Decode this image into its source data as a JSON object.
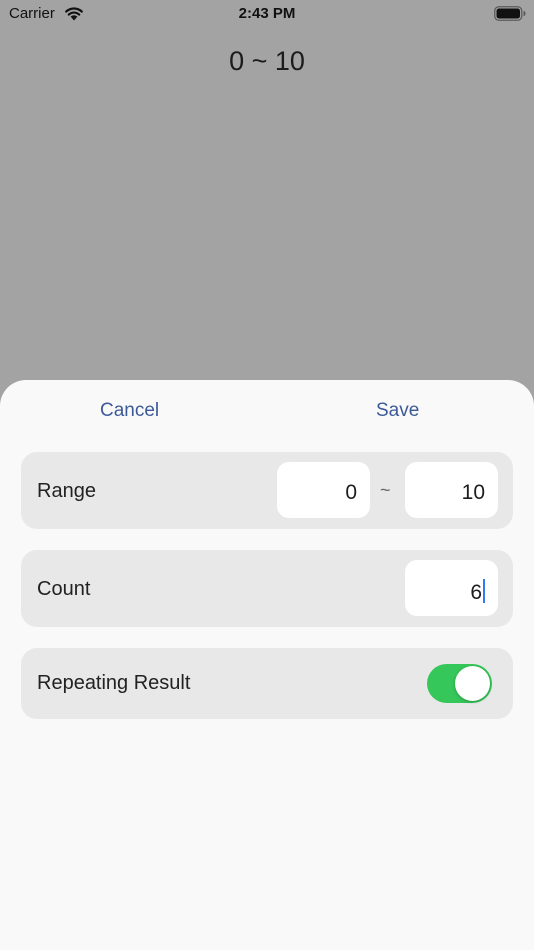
{
  "status_bar": {
    "carrier": "Carrier",
    "time": "2:43 PM",
    "icons": [
      "wifi-icon",
      "battery-icon"
    ]
  },
  "header": {
    "range_text": "0 ~ 10"
  },
  "sheet": {
    "cancel_label": "Cancel",
    "save_label": "Save",
    "range": {
      "label": "Range",
      "min_value": "0",
      "separator": "~",
      "max_value": "10"
    },
    "count": {
      "label": "Count",
      "value": "6"
    },
    "repeating": {
      "label": "Repeating Result",
      "enabled": true
    }
  },
  "colors": {
    "accent": "#3c5a97",
    "toggle_on": "#35c759",
    "dim_background": "#a3a3a3",
    "sheet_background": "#f9f9f9",
    "card_background": "#e8e8e8",
    "caret": "#2f7bf5"
  }
}
